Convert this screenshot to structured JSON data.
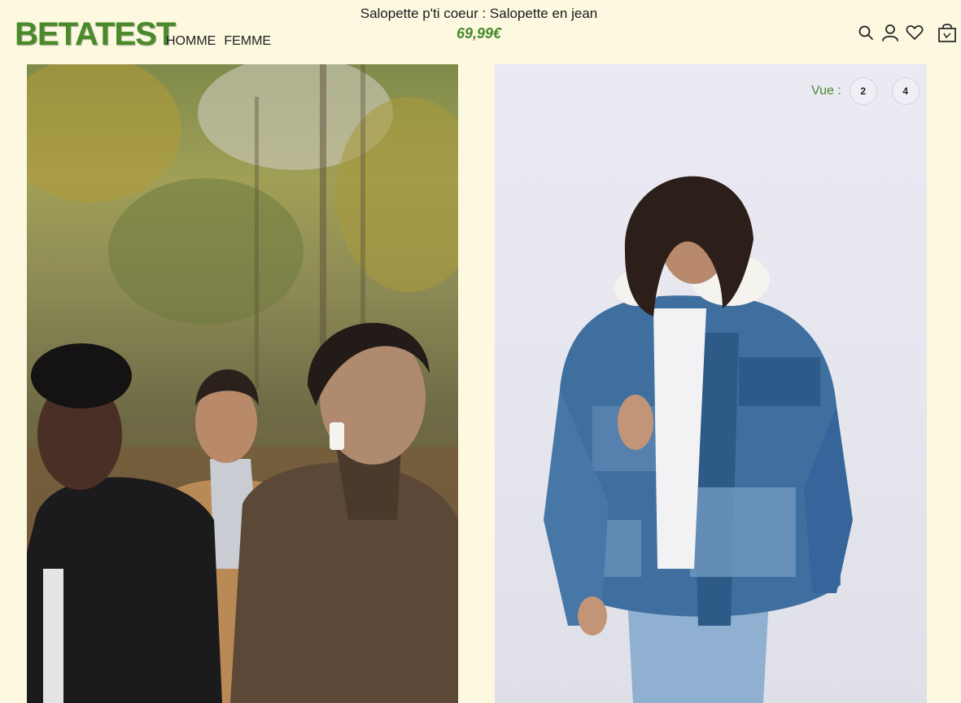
{
  "header": {
    "brand": "BETATEST",
    "nav": [
      {
        "label": "HOMME"
      },
      {
        "label": "FEMME"
      }
    ],
    "product_title": "Salopette p'ti coeur : Salopette en jean",
    "product_price": "69,99€",
    "icons": [
      "search-icon",
      "user-icon",
      "heart-icon",
      "shopping-bag-icon"
    ]
  },
  "view_switch": {
    "label": "Vue :",
    "options": [
      "2",
      "4"
    ]
  },
  "images": [
    {
      "name": "three-men-coats-autumn-photo"
    },
    {
      "name": "man-denim-puffer-jacket-photo"
    }
  ],
  "colors": {
    "background": "#fdf9e1",
    "brand_green": "#4a8a2a",
    "text": "#1e1e1e"
  }
}
